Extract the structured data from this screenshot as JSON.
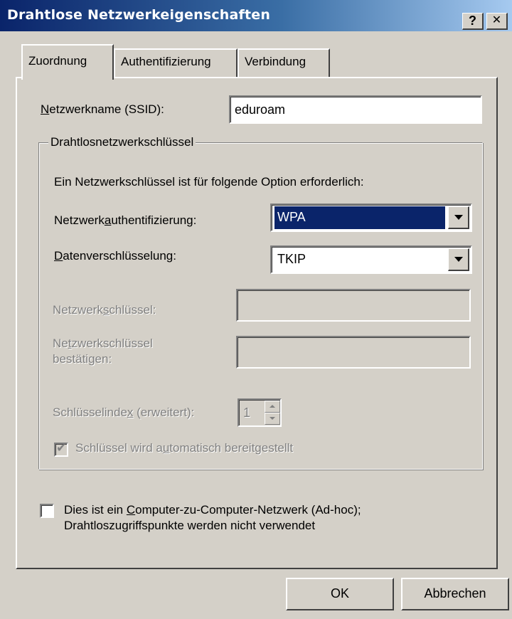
{
  "window": {
    "title": "Drahtlose Netzwerkeigenschaften",
    "help_button": "?",
    "close_button": "✕"
  },
  "tabs": [
    {
      "label": "Zuordnung",
      "active": true
    },
    {
      "label": "Authentifizierung",
      "active": false
    },
    {
      "label": "Verbindung",
      "active": false
    }
  ],
  "ssid": {
    "label_prefix": "",
    "label_mnemonic": "N",
    "label_rest": "etzwerkname (SSID):",
    "value": "eduroam"
  },
  "key_group": {
    "legend": "Drahtlosnetzwerkschlüssel",
    "description": "Ein Netzwerkschlüssel ist für folgende Option erforderlich:",
    "auth": {
      "label_prefix": "Netzwerk",
      "label_mnemonic": "a",
      "label_rest": "uthentifizierung:",
      "value": "WPA"
    },
    "encryption": {
      "label_prefix": "",
      "label_mnemonic": "D",
      "label_rest": "atenverschlüsselung:",
      "value": "TKIP"
    },
    "network_key": {
      "label_prefix": "Netzwerk",
      "label_mnemonic": "s",
      "label_rest": "chlüssel:",
      "value": ""
    },
    "confirm_key": {
      "label_line1_prefix": "Ne",
      "label_line1_mnemonic": "t",
      "label_line1_rest": "zwerkschlüssel",
      "label_line2": "bestätigen:",
      "value": ""
    },
    "key_index": {
      "label_prefix": "Schlüsselinde",
      "label_mnemonic": "x",
      "label_rest": " (erweitert):",
      "value": "1"
    },
    "auto_key": {
      "label_prefix": "Schlüssel wird a",
      "label_mnemonic": "u",
      "label_rest": "tomatisch bereitgestellt",
      "checked": true,
      "check_glyph": "✔"
    }
  },
  "adhoc": {
    "line1_prefix": "Dies ist ein ",
    "line1_mnemonic": "C",
    "line1_rest": "omputer-zu-Computer-Netzwerk (Ad-hoc);",
    "line2": "Drahtloszugriffspunkte werden nicht verwendet",
    "checked": false
  },
  "buttons": {
    "ok": "OK",
    "cancel": "Abbrechen"
  },
  "colors": {
    "dialog_bg": "#d4d0c8",
    "title_start": "#0a246a",
    "title_end": "#a6caf0",
    "selection": "#0a246a",
    "disabled_text": "#808080"
  }
}
